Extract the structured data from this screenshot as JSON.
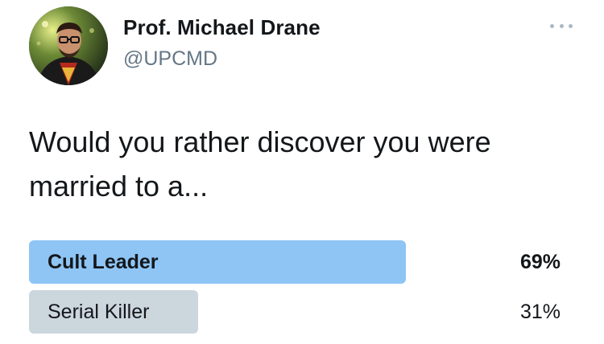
{
  "author": {
    "name": "Prof. Michael Drane",
    "handle": "@UPCMD"
  },
  "tweet": {
    "text_line1": "Would you rather discover you were",
    "text_line2": "married to a..."
  },
  "poll": {
    "options": [
      {
        "label": "Cult Leader",
        "percent_label": "69%",
        "fraction": 0.69,
        "winner": true,
        "bar_color": "#8ec5f5"
      },
      {
        "label": "Serial Killer",
        "percent_label": "31%",
        "fraction": 0.31,
        "winner": false,
        "bar_color": "#ccd6dd"
      }
    ]
  },
  "icons": {
    "more": "more-dots-icon",
    "avatar": "profile-avatar"
  }
}
